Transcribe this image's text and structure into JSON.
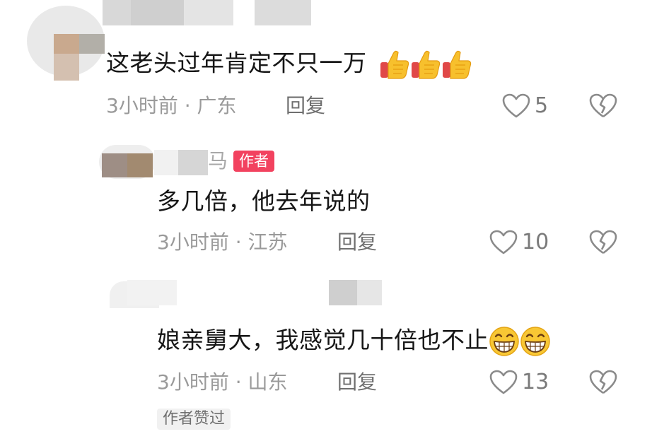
{
  "comments": [
    {
      "text": "这老头过年肯定不只一万",
      "time": "3小时前",
      "location": "· 广东",
      "reply_label": "回复",
      "likes": "5",
      "emoji": "thumbs-up",
      "emoji_count": 3
    },
    {
      "username_fragment": "马",
      "badge": "作者",
      "text": "多几倍，他去年说的",
      "time": "3小时前",
      "location": "· 江苏",
      "reply_label": "回复",
      "likes": "10"
    },
    {
      "text": "娘亲舅大，我感觉几十倍也不止",
      "time": "3小时前",
      "location": "· 山东",
      "reply_label": "回复",
      "likes": "13",
      "emoji": "grinning-face",
      "emoji_count": 2,
      "author_liked_tag": "作者赞过"
    }
  ],
  "colors": {
    "badge": "#f2425f",
    "meta": "#9a9a9a",
    "text": "#161616"
  }
}
